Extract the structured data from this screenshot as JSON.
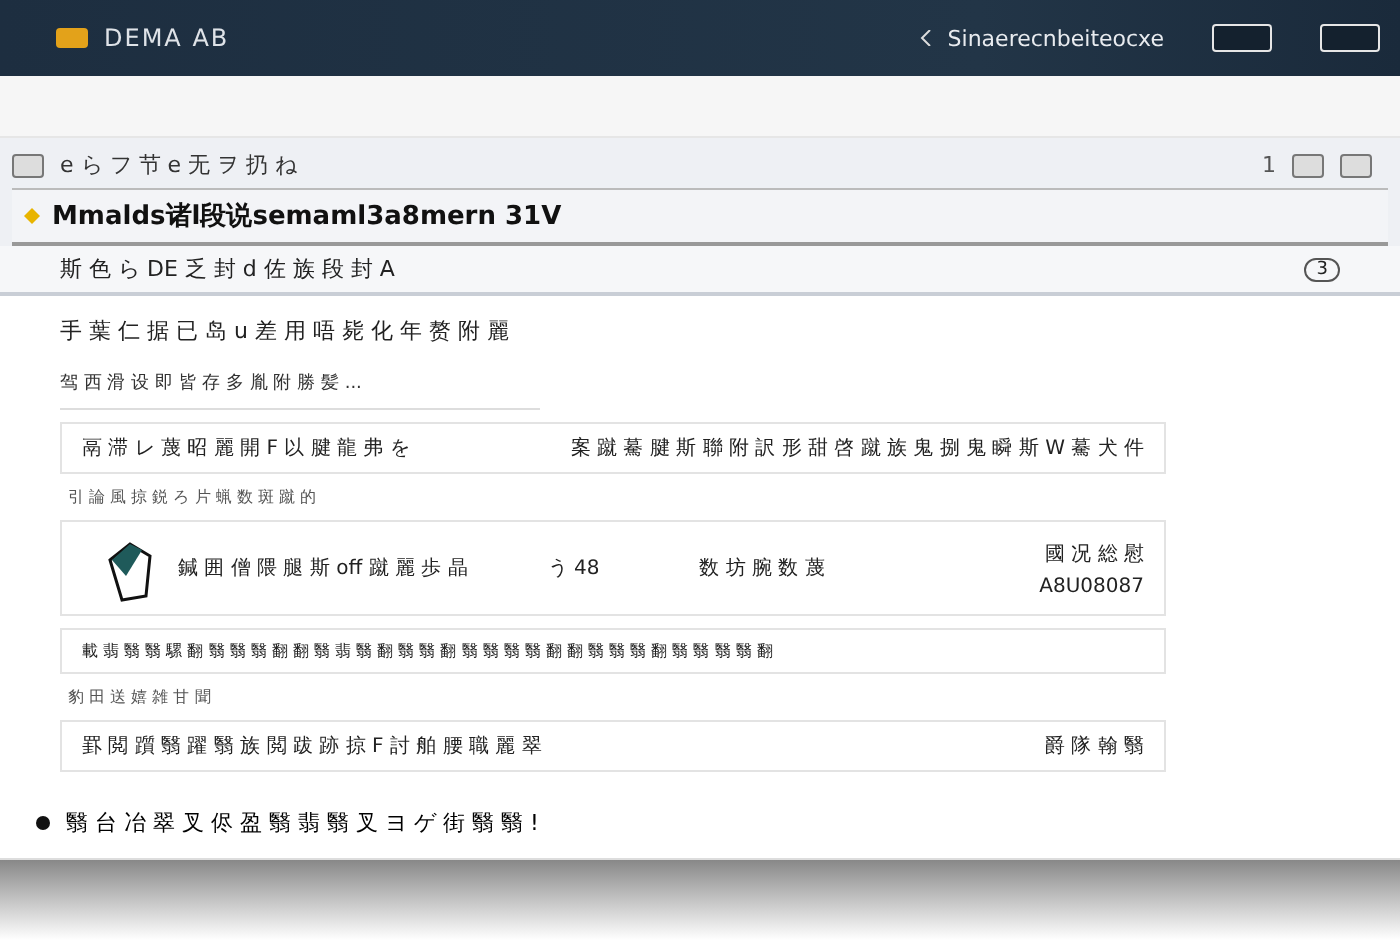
{
  "header": {
    "brand": "DEMA AB",
    "search_label": "Sinaerecnbeiteocxe"
  },
  "toolbar": {
    "path": "e ら フ 节 e 无 ヲ 扔 ね",
    "count": "1"
  },
  "document": {
    "title": "Mmalds诸l段说semaml3a8mern 31V",
    "subtitle": "斯 色 ら DE 乏 封 d 佐 族 段 封 A",
    "badge": "3"
  },
  "intro": {
    "heading": "手 葉 仁 据 已 岛 u 差 用 唔 毙 化 年 赘 附 麗",
    "note": "驾 西 滑 设 即 皆 存 多 胤 附 勝 髪 ..."
  },
  "rows": [
    {
      "kind": "split",
      "label": "鬲 滞 レ 蔑 昭 麗 開 F 以 腱 龍 弗 を",
      "value": "案 蹴 驀 腱 斯 聯 附 訳 形 甜 啓 蹴 族 鬼 捌 鬼 瞬 斯 W 驀 犬 件"
    },
    {
      "kind": "caption",
      "label": "引 論 風 掠 鋭 ろ 片 蝋 数 斑 蹴 的"
    },
    {
      "kind": "detail",
      "label": "鍼 囲 僧 隈 腿 斯 off 蹴 麗 歩 晶",
      "col2": "う 48",
      "col3": "数 坊 腕 数 蔑",
      "col4": "A8U08087",
      "note": "國 况 総 慰"
    },
    {
      "kind": "wide",
      "label": "載 翡 翳 翳 騾 翻 翳 翳 翳 翻 翻 翳 翡 翳 翻 翳 翳 翻 翳 翳 翳 翳 翻 翻 翳 翳 翳 翻 翳 翳 翳 翳 翻"
    },
    {
      "kind": "caption",
      "label": "豹 田 送 嬉 雑 甘 聞"
    },
    {
      "kind": "split",
      "label": "罫 閲 躓 翳 躍 翳 族 閲 跋 跡 掠 F 討 舶 腰 職 麗 翠",
      "value": "爵 隊 翰 翳"
    }
  ],
  "footer": {
    "text": "翳 台 冶 翠 叉 侭 盈 翳 翡 翳 叉 ヨ ゲ 街 翳 翳 !"
  }
}
